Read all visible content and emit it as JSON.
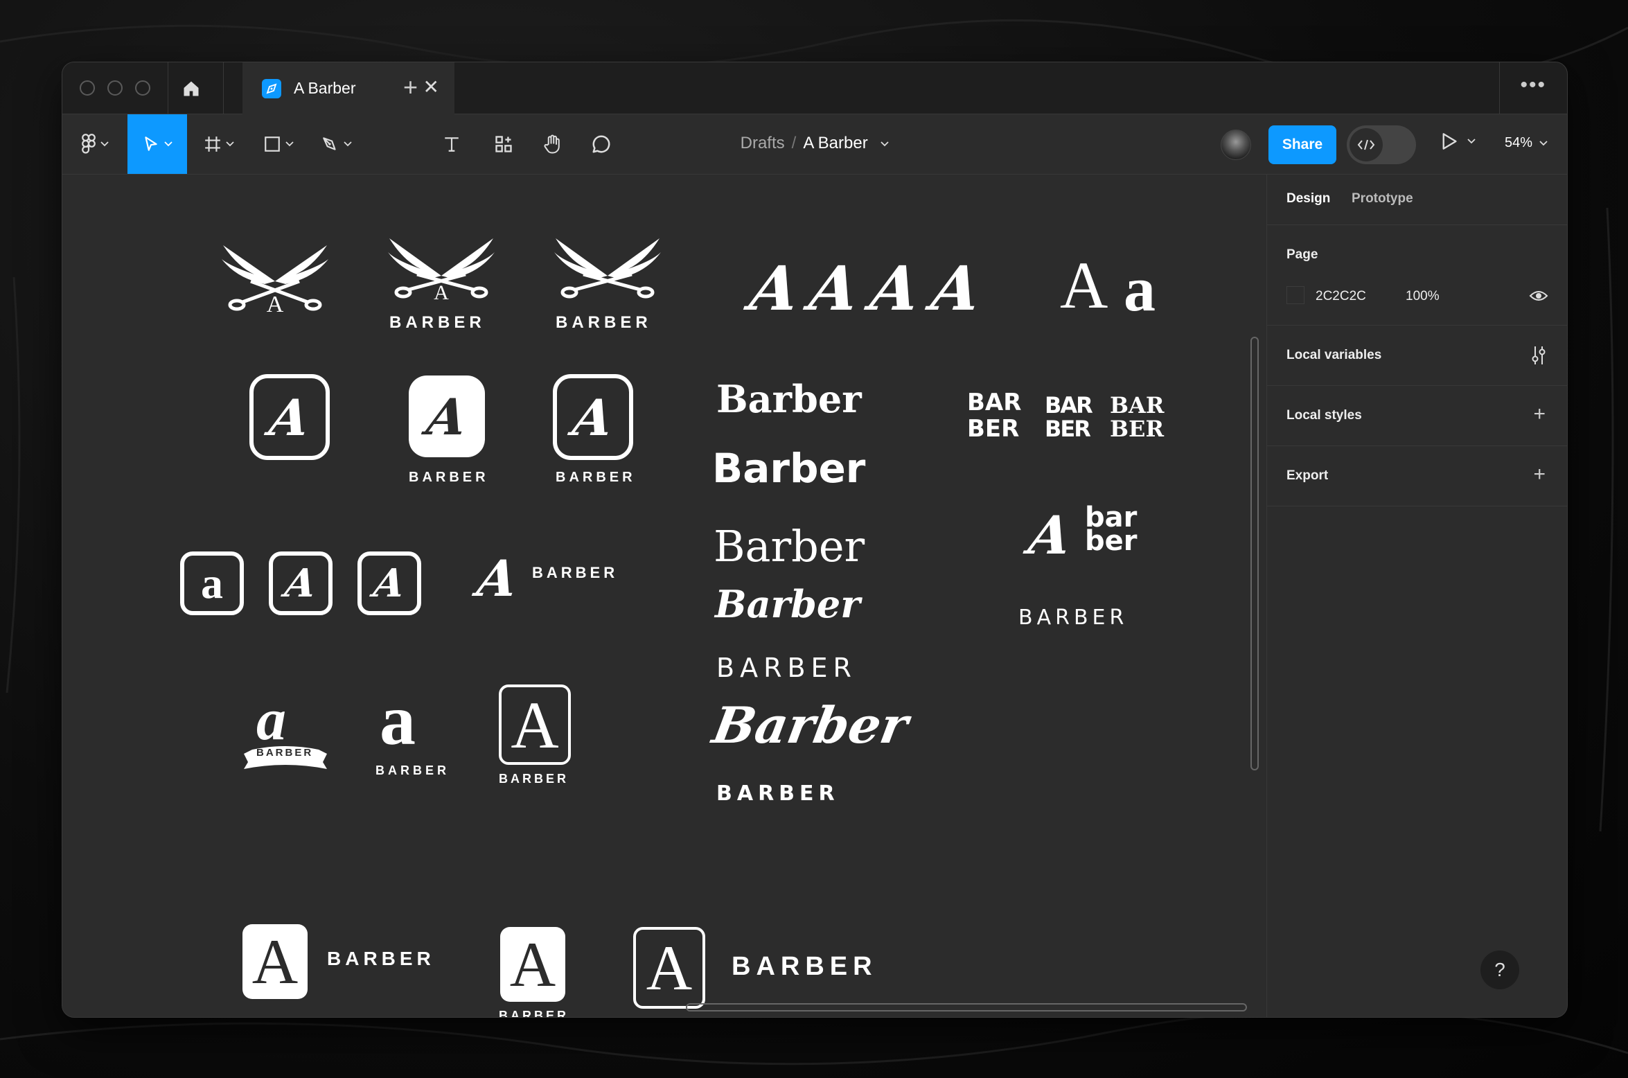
{
  "window": {
    "tab": {
      "title": "A Barber",
      "close": "✕"
    },
    "new_tab": "+",
    "more": "•••"
  },
  "toolbar": {
    "breadcrumb": {
      "parent": "Drafts",
      "separator": "/",
      "file": "A Barber"
    },
    "share_label": "Share",
    "dev_mode_icon": "code-icon",
    "zoom": "54%"
  },
  "canvas": {
    "wings_row": [
      "A",
      "BARBER",
      "BARBER"
    ],
    "blackletter_a_row": [
      "A",
      "A",
      "A",
      "A"
    ],
    "serif_pair": {
      "upper": "A",
      "lower": "a"
    },
    "app_icons": {
      "glyph": "A",
      "label_1": "BARBER",
      "label_2": "BARBER"
    },
    "wordmarks": [
      "Barber",
      "Barber",
      "Barber",
      "Barber",
      "BARBER",
      "Barber",
      "BARBER"
    ],
    "stacked": [
      [
        "BAR",
        "BER"
      ],
      [
        "BAR",
        "BER"
      ],
      [
        "BAR",
        "BER"
      ]
    ],
    "bar_ber_lockup": {
      "glyph": "A",
      "line1": "bar",
      "line2": "ber"
    },
    "barber_caps": "BARBER",
    "small_icons": [
      "a",
      "A",
      "A"
    ],
    "horizontal_lockup": {
      "glyph": "A",
      "word": "BARBER"
    },
    "badges": [
      {
        "glyph": "a",
        "label": "BARBER"
      },
      {
        "glyph": "a",
        "label": "BARBER"
      },
      {
        "glyph": "A",
        "label": "BARBER"
      }
    ],
    "bottom_row": [
      {
        "glyph": "A",
        "label": "BARBER"
      },
      {
        "glyph": "A",
        "label": "BARBER"
      },
      {
        "glyph": "A",
        "label": "BARBER"
      }
    ]
  },
  "panel": {
    "tabs": [
      "Design",
      "Prototype"
    ],
    "page": {
      "title": "Page",
      "color_hex": "2C2C2C",
      "opacity": "100%",
      "swatch": "#2c2c2c"
    },
    "sections": [
      "Local variables",
      "Local styles",
      "Export"
    ],
    "help": "?"
  },
  "colors": {
    "accent": "#0d99ff",
    "canvas": "#2c2c2c",
    "chrome": "#1e1e1e"
  }
}
